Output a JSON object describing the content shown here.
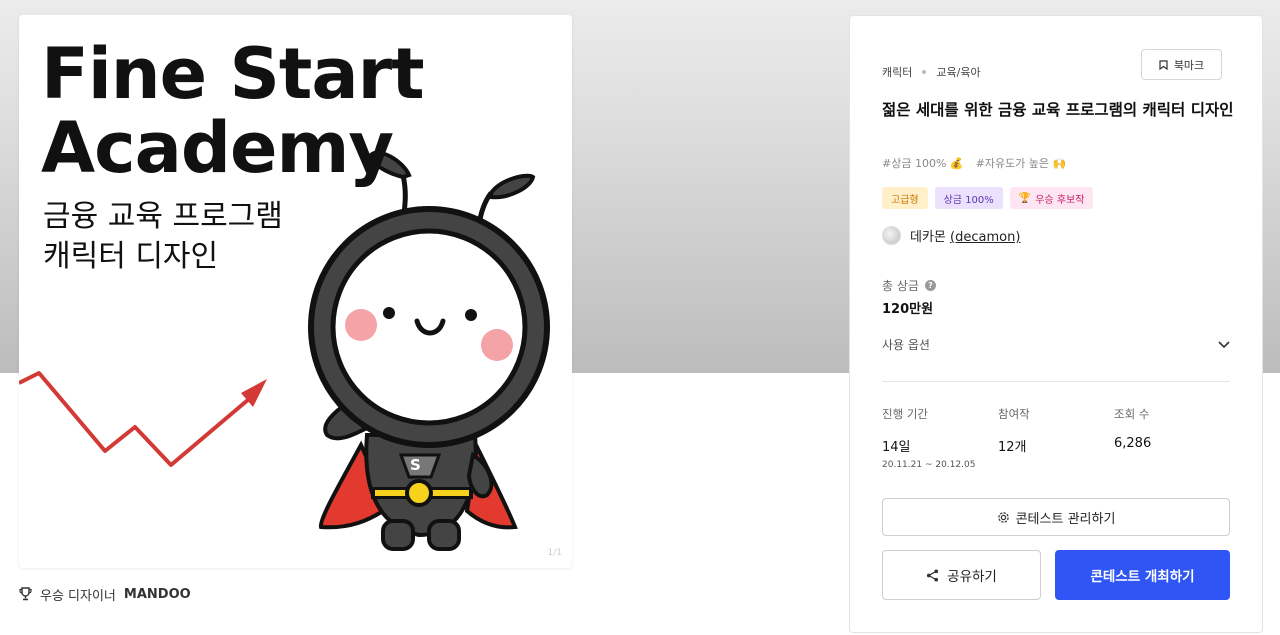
{
  "colors": {
    "accent": "#2f55f4",
    "badge_premium": "#fff0c9",
    "badge_prize": "#ebe1fd",
    "badge_award": "#fde6f1"
  },
  "artwork": {
    "title_line1": "Fine Start",
    "title_line2": "Academy",
    "subtitle_line1": "금융 교육 프로그램",
    "subtitle_line2": "캐릭터 디자인",
    "mascot_letter": "S",
    "watermark": "1/1"
  },
  "winner": {
    "label": "우승 디자이너",
    "name": "MANDOO",
    "icon": "trophy-icon"
  },
  "panel": {
    "category": "캐릭터",
    "subcategory": "교육/육아",
    "bookmark_label": "북마크",
    "title": "젊은 세대를 위한 금융 교육 프로그램의 캐릭터 디자인",
    "tags": [
      "#상금 100% 💰",
      "#자유도가 높은 🙌"
    ],
    "badges": {
      "premium": "고급형",
      "prize": "상금 100%",
      "award": "우승 후보작"
    },
    "author": {
      "name": "데카몬",
      "handle": "(decamon)"
    },
    "prize": {
      "label": "총 상금",
      "value": "120만원"
    },
    "options_label": "사용 옵션",
    "stats": {
      "duration": {
        "label": "진행 기간",
        "value": "14일",
        "range": "20.11.21  ~  20.12.05"
      },
      "entries": {
        "label": "참여작",
        "value": "12개"
      },
      "views": {
        "label": "조회 수",
        "value": "6,286"
      }
    },
    "manage_button": "콘테스트 관리하기",
    "share_button": "공유하기",
    "host_button": "콘테스트 개최하기"
  }
}
